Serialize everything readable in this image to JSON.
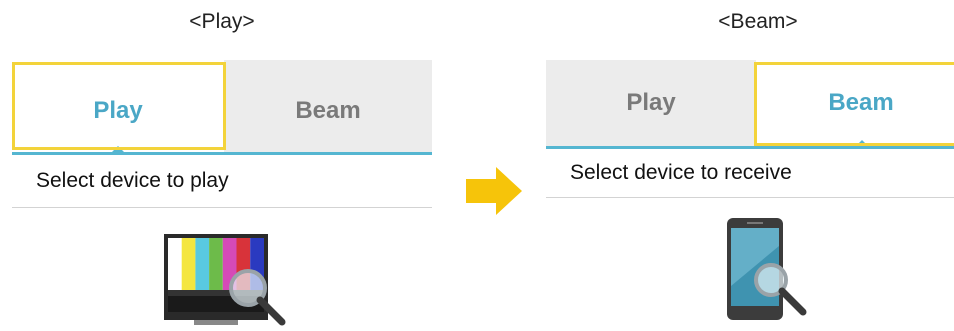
{
  "panels": [
    {
      "caption": "<Play>",
      "tabs": [
        {
          "label": "Play",
          "active": true
        },
        {
          "label": "Beam",
          "active": false
        }
      ],
      "prompt": "Select device to play",
      "device_icon": "tv-search-icon"
    },
    {
      "caption": "<Beam>",
      "tabs": [
        {
          "label": "Play",
          "active": false
        },
        {
          "label": "Beam",
          "active": true
        }
      ],
      "prompt": "Select device to receive",
      "device_icon": "phone-search-icon"
    }
  ],
  "colors": {
    "accent": "#4aa7c6",
    "tab_line": "#55b6d1",
    "highlight": "#f3d33a",
    "arrow": "#f6c40a",
    "inactive_tab_bg": "#ececec",
    "inactive_tab_text": "#7a7a7a"
  },
  "transition_icon": "right-arrow-icon"
}
